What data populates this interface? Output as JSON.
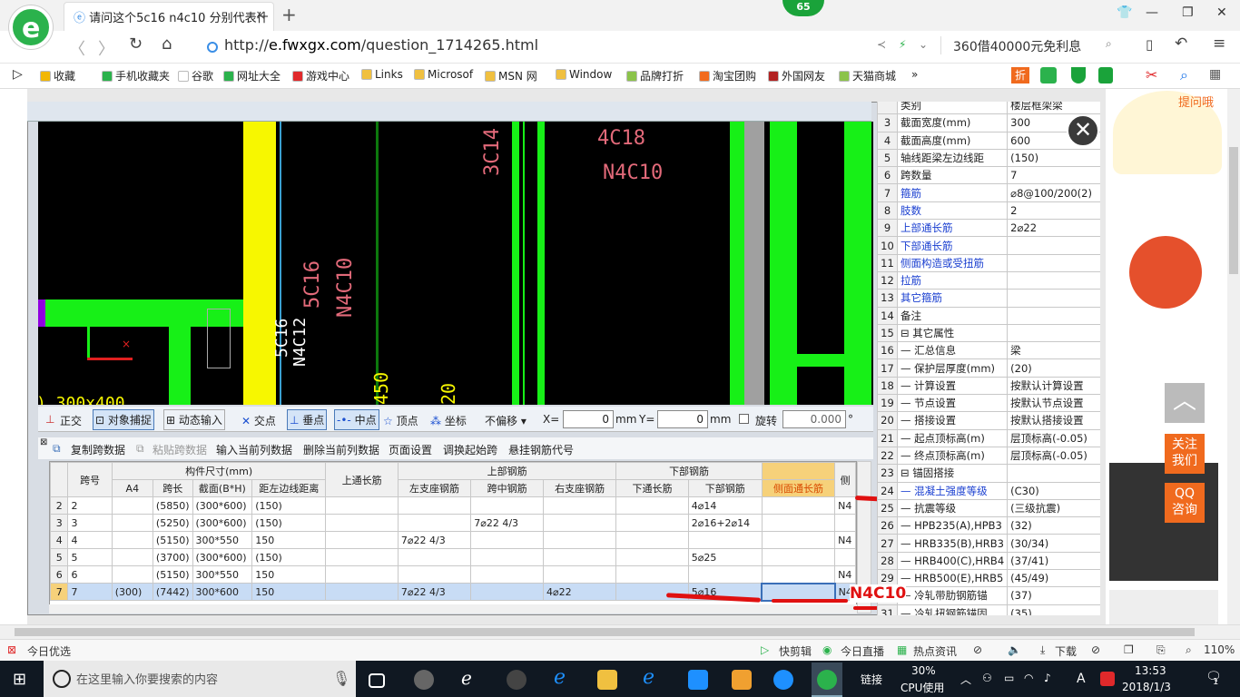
{
  "browser": {
    "tab_title": "请问这个5c16 n4c10 分别代表什",
    "tab_close": "×",
    "new_tab": "+",
    "badge_count": "65",
    "url_prefix": "http://",
    "url_domain": "e.fwxgx.com",
    "url_path": "/question_1714265.html",
    "ad_text": "360借40000元免利息",
    "logo_letter": "e"
  },
  "bookmarks": [
    {
      "label": "收藏",
      "color": "#f2b705"
    },
    {
      "label": "手机收藏夹",
      "color": "#2bb24c"
    },
    {
      "label": "谷歌",
      "color": "#ffffff"
    },
    {
      "label": "网址大全",
      "color": "#2bb24c"
    },
    {
      "label": "游戏中心",
      "color": "#e0292b"
    },
    {
      "label": "Links",
      "color": "#f0c040"
    },
    {
      "label": "Microsof",
      "color": "#f0c040"
    },
    {
      "label": "MSN 网",
      "color": "#f0c040"
    },
    {
      "label": "Window",
      "color": "#f0c040"
    },
    {
      "label": "品牌打折",
      "color": "#8bc34a"
    },
    {
      "label": "淘宝团购",
      "color": "#f26b1d"
    },
    {
      "label": "外国网友",
      "color": "#b22222"
    },
    {
      "label": "天猫商城",
      "color": "#8bc34a"
    }
  ],
  "bookmark_more": "»",
  "cad": {
    "texts": {
      "t3c14": "3C14",
      "t4c18": "4C18",
      "tn4c10a": "N4C10",
      "t5c16": "5C16",
      "tn4c10b": "N4C10",
      "t5c16b": "5C16",
      "tn4c12": "N4C12",
      "t450": "450",
      "t300": ") 300x400",
      "t20": "20",
      "tparen": ")"
    },
    "toolbar_items": [
      "正交",
      "对象捕捉",
      "动态输入",
      "交点",
      "垂点",
      "中点",
      "顶点",
      "坐标",
      "不偏移"
    ],
    "x_label": "X=",
    "x_value": "0",
    "mm1": "mm",
    "y_label": "Y=",
    "y_value": "0",
    "mm2": "mm",
    "rotate_label": "旋转",
    "rotate_value": "0.000",
    "degree": "°"
  },
  "grid_toolbar": [
    "复制跨数据",
    "粘贴跨数据",
    "输入当前列数据",
    "删除当前列数据",
    "页面设置",
    "调换起始跨",
    "悬挂钢筋代号"
  ],
  "grid": {
    "header_top": {
      "span": "跨号",
      "size": "构件尺寸(mm)",
      "top_through": "上通长筋",
      "upper": "上部钢筋",
      "lower": "下部钢筋"
    },
    "header_sub": [
      "A4",
      "跨长",
      "截面(B*H)",
      "距左边线距离",
      "左支座钢筋",
      "跨中钢筋",
      "右支座钢筋",
      "下通长筋",
      "下部钢筋",
      "侧面通长筋",
      "侧"
    ],
    "rows": [
      {
        "n": "2",
        "span": "2",
        "a4": "",
        "len": "(5850)",
        "sec": "(300*600)",
        "dist": "(150)",
        "top": "",
        "left": "",
        "mid": "",
        "right": "",
        "bthru": "",
        "bottom": "4⌀14",
        "side": "",
        "x": "N4"
      },
      {
        "n": "3",
        "span": "3",
        "a4": "",
        "len": "(5250)",
        "sec": "(300*600)",
        "dist": "(150)",
        "top": "",
        "left": "",
        "mid": "7⌀22 4/3",
        "right": "",
        "bthru": "",
        "bottom": "2⌀16+2⌀14",
        "side": "",
        "x": ""
      },
      {
        "n": "4",
        "span": "4",
        "a4": "",
        "len": "(5150)",
        "sec": "300*550",
        "dist": "150",
        "top": "",
        "left": "7⌀22 4/3",
        "mid": "",
        "right": "",
        "bthru": "",
        "bottom": "",
        "side": "",
        "x": "N4"
      },
      {
        "n": "5",
        "span": "5",
        "a4": "",
        "len": "(3700)",
        "sec": "(300*600)",
        "dist": "(150)",
        "top": "",
        "left": "",
        "mid": "",
        "right": "",
        "bthru": "",
        "bottom": "5⌀25",
        "side": "",
        "x": ""
      },
      {
        "n": "6",
        "span": "6",
        "a4": "",
        "len": "(5150)",
        "sec": "300*550",
        "dist": "150",
        "top": "",
        "left": "",
        "mid": "",
        "right": "",
        "bthru": "",
        "bottom": "",
        "side": "",
        "x": "N4"
      },
      {
        "n": "7",
        "span": "7",
        "a4": "(300)",
        "len": "(7442)",
        "sec": "300*600",
        "dist": "150",
        "top": "",
        "left": "7⌀22 4/3",
        "mid": "",
        "right": "4⌀22",
        "bthru": "",
        "bottom": "5⌀16",
        "side": "",
        "x": "N4"
      }
    ]
  },
  "annotation": "N4C10",
  "props": [
    {
      "i": "",
      "k": "类别",
      "v": "楼层框架梁",
      "blue": false
    },
    {
      "i": "3",
      "k": "截面宽度(mm)",
      "v": "300",
      "blue": false
    },
    {
      "i": "4",
      "k": "截面高度(mm)",
      "v": "600",
      "blue": false
    },
    {
      "i": "5",
      "k": "轴线距梁左边线距",
      "v": "(150)",
      "blue": false
    },
    {
      "i": "6",
      "k": "跨数量",
      "v": "7",
      "blue": false
    },
    {
      "i": "7",
      "k": "箍筋",
      "v": "⌀8@100/200(2)",
      "blue": true
    },
    {
      "i": "8",
      "k": "肢数",
      "v": "2",
      "blue": true
    },
    {
      "i": "9",
      "k": "上部通长筋",
      "v": "2⌀22",
      "blue": true
    },
    {
      "i": "10",
      "k": "下部通长筋",
      "v": "",
      "blue": true
    },
    {
      "i": "11",
      "k": "侧面构造或受扭筋",
      "v": "",
      "blue": true
    },
    {
      "i": "12",
      "k": "拉筋",
      "v": "",
      "blue": true
    },
    {
      "i": "13",
      "k": "其它箍筋",
      "v": "",
      "blue": true
    },
    {
      "i": "14",
      "k": "备注",
      "v": "",
      "blue": false
    },
    {
      "i": "15",
      "k": "⊟ 其它属性",
      "v": "",
      "blue": false
    },
    {
      "i": "16",
      "k": "— 汇总信息",
      "v": "梁",
      "blue": false
    },
    {
      "i": "17",
      "k": "— 保护层厚度(mm)",
      "v": "(20)",
      "blue": false
    },
    {
      "i": "18",
      "k": "— 计算设置",
      "v": "按默认计算设置",
      "blue": false
    },
    {
      "i": "19",
      "k": "— 节点设置",
      "v": "按默认节点设置",
      "blue": false
    },
    {
      "i": "20",
      "k": "— 搭接设置",
      "v": "按默认搭接设置",
      "blue": false
    },
    {
      "i": "21",
      "k": "— 起点顶标高(m)",
      "v": "层顶标高(-0.05)",
      "blue": false
    },
    {
      "i": "22",
      "k": "— 终点顶标高(m)",
      "v": "层顶标高(-0.05)",
      "blue": false
    },
    {
      "i": "23",
      "k": "⊟ 锚固搭接",
      "v": "",
      "blue": false
    },
    {
      "i": "24",
      "k": "— 混凝土强度等级",
      "v": "(C30)",
      "blue": true
    },
    {
      "i": "25",
      "k": "— 抗震等级",
      "v": "(三级抗震)",
      "blue": false
    },
    {
      "i": "26",
      "k": "— HPB235(A),HPB3",
      "v": "(32)",
      "blue": false
    },
    {
      "i": "27",
      "k": "— HRB335(B),HRB3",
      "v": "(30/34)",
      "blue": false
    },
    {
      "i": "28",
      "k": "— HRB400(C),HRB4",
      "v": "(37/41)",
      "blue": false
    },
    {
      "i": "29",
      "k": "— HRB500(E),HRB5",
      "v": "(45/49)",
      "blue": false
    },
    {
      "i": "30",
      "k": "— 冷轧带肋钢筋锚",
      "v": "(37)",
      "blue": false
    },
    {
      "i": "31",
      "k": "— 冷轧扭钢筋锚固",
      "v": "(35)",
      "blue": false
    }
  ],
  "side": {
    "follow": "关注我们",
    "qq": "QQ咨询",
    "ask": "提问哦"
  },
  "status": {
    "left": "今日优选",
    "kuaijianji": "快剪辑",
    "live": "今日直播",
    "news": "热点资讯",
    "download": "下载",
    "zoom": "110%"
  },
  "taskbar": {
    "search_placeholder": "在这里输入你要搜索的内容",
    "link": "链接",
    "cpu_pct": "30%",
    "cpu_label": "CPU使用",
    "ime": "A",
    "time": "13:53",
    "date": "2018/1/3",
    "notif": "1"
  }
}
